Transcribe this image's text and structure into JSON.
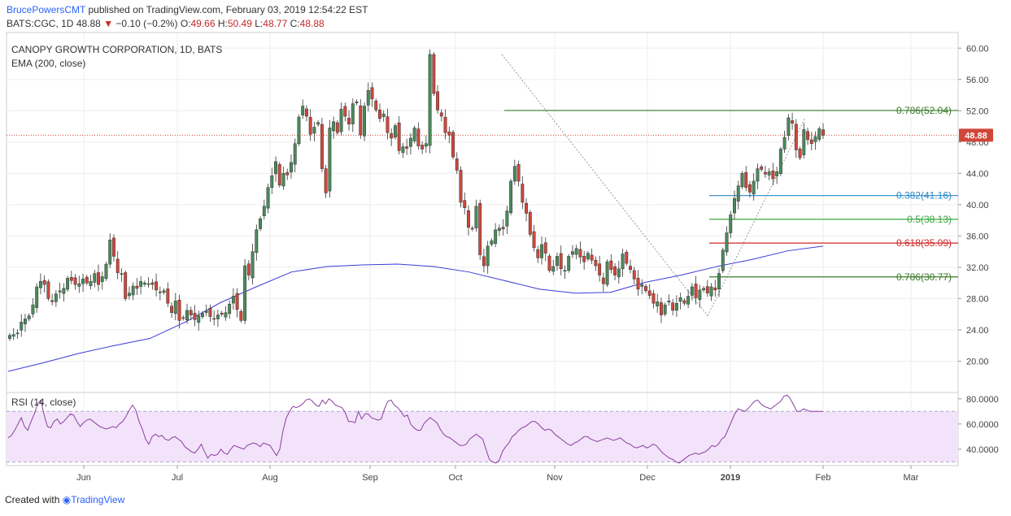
{
  "header": {
    "author": "BrucePowersCMT",
    "published_text": "published on TradingView.com, February 03, 2019 12:54:22 EST",
    "symbol": "BATS:CGC, 1D",
    "last": "48.88",
    "change": "−0.10 (−0.2%)",
    "o_label": "O:",
    "o": "49.66",
    "h_label": "H:",
    "h": "50.49",
    "l_label": "L:",
    "l": "48.77",
    "c_label": "C:",
    "c": "48.88"
  },
  "footer": {
    "created_with": "Created with",
    "brand": "TradingView"
  },
  "colors": {
    "up": "#4a8a5a",
    "down": "#d0473a",
    "ema": "#3b3bd6",
    "rsi": "#8a3fa0",
    "rsi_band": "#f3e3fa",
    "grid": "#eeeeee",
    "fib_786_top": "#3a7a2a",
    "fib_382": "#2a8ac9",
    "fib_5": "#3aa840",
    "fib_618": "#d02a2a",
    "fib_786_bottom": "#3a7a2a"
  },
  "chart_data": [
    {
      "type": "candlestick",
      "title": "CANOPY GROWTH CORPORATION, 1D, BATS",
      "indicator_label": "EMA (200, close)",
      "last_price_label": "48.88",
      "ylim": [
        16,
        62
      ],
      "y_ticks": [
        "60.00",
        "56.00",
        "52.00",
        "48.00",
        "44.00",
        "40.00",
        "36.00",
        "32.00",
        "28.00",
        "24.00",
        "20.00"
      ],
      "x_ticks": [
        "Jun",
        "Jul",
        "Aug",
        "Sep",
        "Oct",
        "Nov",
        "Dec",
        "2019",
        "Feb",
        "Mar"
      ],
      "closes": [
        23.3,
        23.4,
        23.6,
        25.0,
        25.4,
        25.8,
        27.2,
        29.5,
        30.2,
        29.8,
        28.0,
        27.6,
        28.6,
        29.0,
        29.3,
        30.6,
        30.3,
        29.8,
        29.9,
        30.5,
        30.0,
        30.2,
        31.2,
        29.8,
        30.8,
        32.4,
        35.5,
        33.4,
        31.3,
        31.2,
        28.0,
        28.7,
        29.6,
        29.3,
        30.2,
        30.0,
        29.9,
        29.8,
        29.1,
        28.8,
        29.0,
        27.4,
        26.2,
        27.7,
        25.2,
        25.5,
        26.5,
        25.9,
        25.3,
        25.8,
        26.1,
        26.4,
        25.7,
        25.4,
        25.9,
        26.0,
        26.2,
        27.3,
        28.3,
        26.6,
        25.2,
        32.2,
        31.0,
        34.0,
        36.8,
        38.2,
        39.8,
        42.2,
        43.7,
        45.5,
        42.5,
        44.0,
        43.8,
        45.4,
        47.8,
        51.2,
        52.6,
        51.3,
        49.0,
        49.9,
        50.5,
        44.6,
        41.5,
        49.8,
        50.6,
        49.2,
        52.2,
        51.3,
        50.3,
        52.9,
        53.0,
        48.9,
        52.6,
        54.6,
        53.5,
        52.1,
        51.0,
        51.6,
        49.2,
        48.5,
        50.1,
        46.9,
        47.4,
        47.2,
        48.5,
        49.8,
        47.5,
        47.1,
        47.8,
        59.2,
        54.2,
        52.1,
        51.3,
        49.2,
        48.9,
        46.1,
        44.4,
        40.3,
        39.6,
        37.1,
        36.9,
        39.8,
        33.6,
        32.2,
        34.7,
        35.4,
        36.8,
        37.0,
        36.9,
        39.2,
        43.0,
        44.9,
        43.0,
        40.3,
        38.9,
        36.2,
        34.5,
        33.2,
        34.9,
        33.8,
        31.6,
        32.1,
        33.4,
        31.8,
        31.6,
        33.4,
        34.0,
        34.4,
        33.3,
        32.7,
        33.8,
        32.9,
        32.2,
        31.0,
        29.9,
        32.7,
        31.7,
        31.0,
        31.8,
        33.7,
        32.5,
        31.7,
        30.5,
        29.2,
        29.8,
        29.0,
        28.4,
        27.4,
        27.6,
        25.9,
        27.2,
        27.7,
        26.5,
        27.4,
        28.1,
        27.4,
        28.3,
        29.5,
        28.1,
        29.1,
        29.3,
        28.7,
        29.5,
        29.1,
        31.2,
        34.2,
        36.4,
        38.7,
        40.8,
        42.4,
        44.0,
        42.2,
        41.6,
        43.0,
        44.6,
        44.5,
        43.9,
        44.2,
        43.3,
        44.2,
        47.1,
        48.6,
        51.1,
        50.4,
        47.0,
        46.0,
        49.6,
        48.3,
        47.8,
        48.7,
        49.7,
        48.88
      ],
      "ema_200": [
        18.7,
        19.8,
        21.0,
        22.0,
        22.9,
        25.0,
        27.5,
        29.5,
        31.4,
        32.1,
        32.3,
        32.4,
        32.1,
        31.4,
        30.3,
        29.2,
        28.7,
        28.8,
        30.1,
        31.0,
        32.1,
        33.0,
        34.1,
        34.7
      ],
      "fib_levels": [
        {
          "label": "0.786(52.04)",
          "value": 52.04
        },
        {
          "label": "0.382(41.16)",
          "value": 41.16
        },
        {
          "label": "0.5(38.13)",
          "value": 38.13
        },
        {
          "label": "0.618(35.09)",
          "value": 35.09
        },
        {
          "label": "0.786(30.77)",
          "value": 30.77
        }
      ]
    },
    {
      "type": "line",
      "title": "RSI (14, close)",
      "ylim": [
        27,
        85
      ],
      "y_ticks": [
        "80.0000",
        "60.0000",
        "40.0000"
      ],
      "band": [
        30,
        70
      ],
      "values": [
        49,
        51,
        55,
        60,
        65,
        58,
        55,
        62,
        68,
        76,
        79,
        67,
        58,
        57,
        62,
        64,
        60,
        62,
        65,
        68,
        67,
        62,
        58,
        61,
        63,
        64,
        62,
        60,
        58,
        57,
        56,
        57,
        58,
        57,
        60,
        62,
        66,
        71,
        75,
        71,
        62,
        56,
        48,
        44,
        50,
        52,
        50,
        51,
        48,
        47,
        49,
        50,
        48,
        46,
        42,
        40,
        38,
        37,
        40,
        44,
        38,
        33,
        36,
        35,
        36,
        40,
        37,
        36,
        40,
        43,
        42,
        41,
        40,
        43,
        44,
        45,
        44,
        42,
        45,
        44,
        43,
        39,
        35,
        40,
        55,
        65,
        70,
        74,
        73,
        74,
        76,
        79,
        80,
        78,
        75,
        74,
        79,
        76,
        80,
        78,
        75,
        74,
        73,
        69,
        62,
        62,
        61,
        70,
        64,
        68,
        68,
        65,
        64,
        63,
        64,
        72,
        78,
        79,
        75,
        73,
        70,
        66,
        67,
        60,
        57,
        55,
        55,
        60,
        63,
        65,
        63,
        61,
        56,
        52,
        50,
        49,
        47,
        45,
        43,
        43,
        44,
        48,
        50,
        52,
        50,
        48,
        40,
        32,
        30,
        29,
        31,
        38,
        42,
        45,
        50,
        52,
        55,
        57,
        58,
        60,
        62,
        62,
        60,
        57,
        55,
        56,
        55,
        52,
        50,
        48,
        46,
        44,
        43,
        45,
        46,
        48,
        50,
        50,
        48,
        47,
        46,
        47,
        48,
        49,
        48,
        47,
        48,
        49,
        47,
        45,
        44,
        42,
        41,
        42,
        43,
        41,
        42,
        44,
        43,
        40,
        37,
        35,
        33,
        32,
        30,
        29,
        31,
        33,
        35,
        36,
        37,
        36,
        37,
        38,
        40,
        43,
        42,
        44,
        48,
        50,
        56,
        62,
        68,
        72,
        71,
        70,
        72,
        75,
        78,
        79,
        76,
        74,
        73,
        72,
        74,
        76,
        78,
        82,
        83,
        80,
        75,
        70,
        70,
        72,
        71,
        70,
        70,
        70,
        70,
        70,
        70,
        70,
        70,
        70,
        70,
        70,
        70,
        70,
        70,
        70,
        70,
        70,
        70,
        70,
        70,
        70,
        70,
        70,
        70,
        70,
        70,
        70,
        70,
        70,
        70,
        70,
        70,
        70,
        70,
        70,
        70,
        70,
        70,
        70,
        70,
        70,
        70,
        70,
        70,
        70,
        70,
        70,
        70,
        70,
        70,
        70
      ]
    }
  ]
}
